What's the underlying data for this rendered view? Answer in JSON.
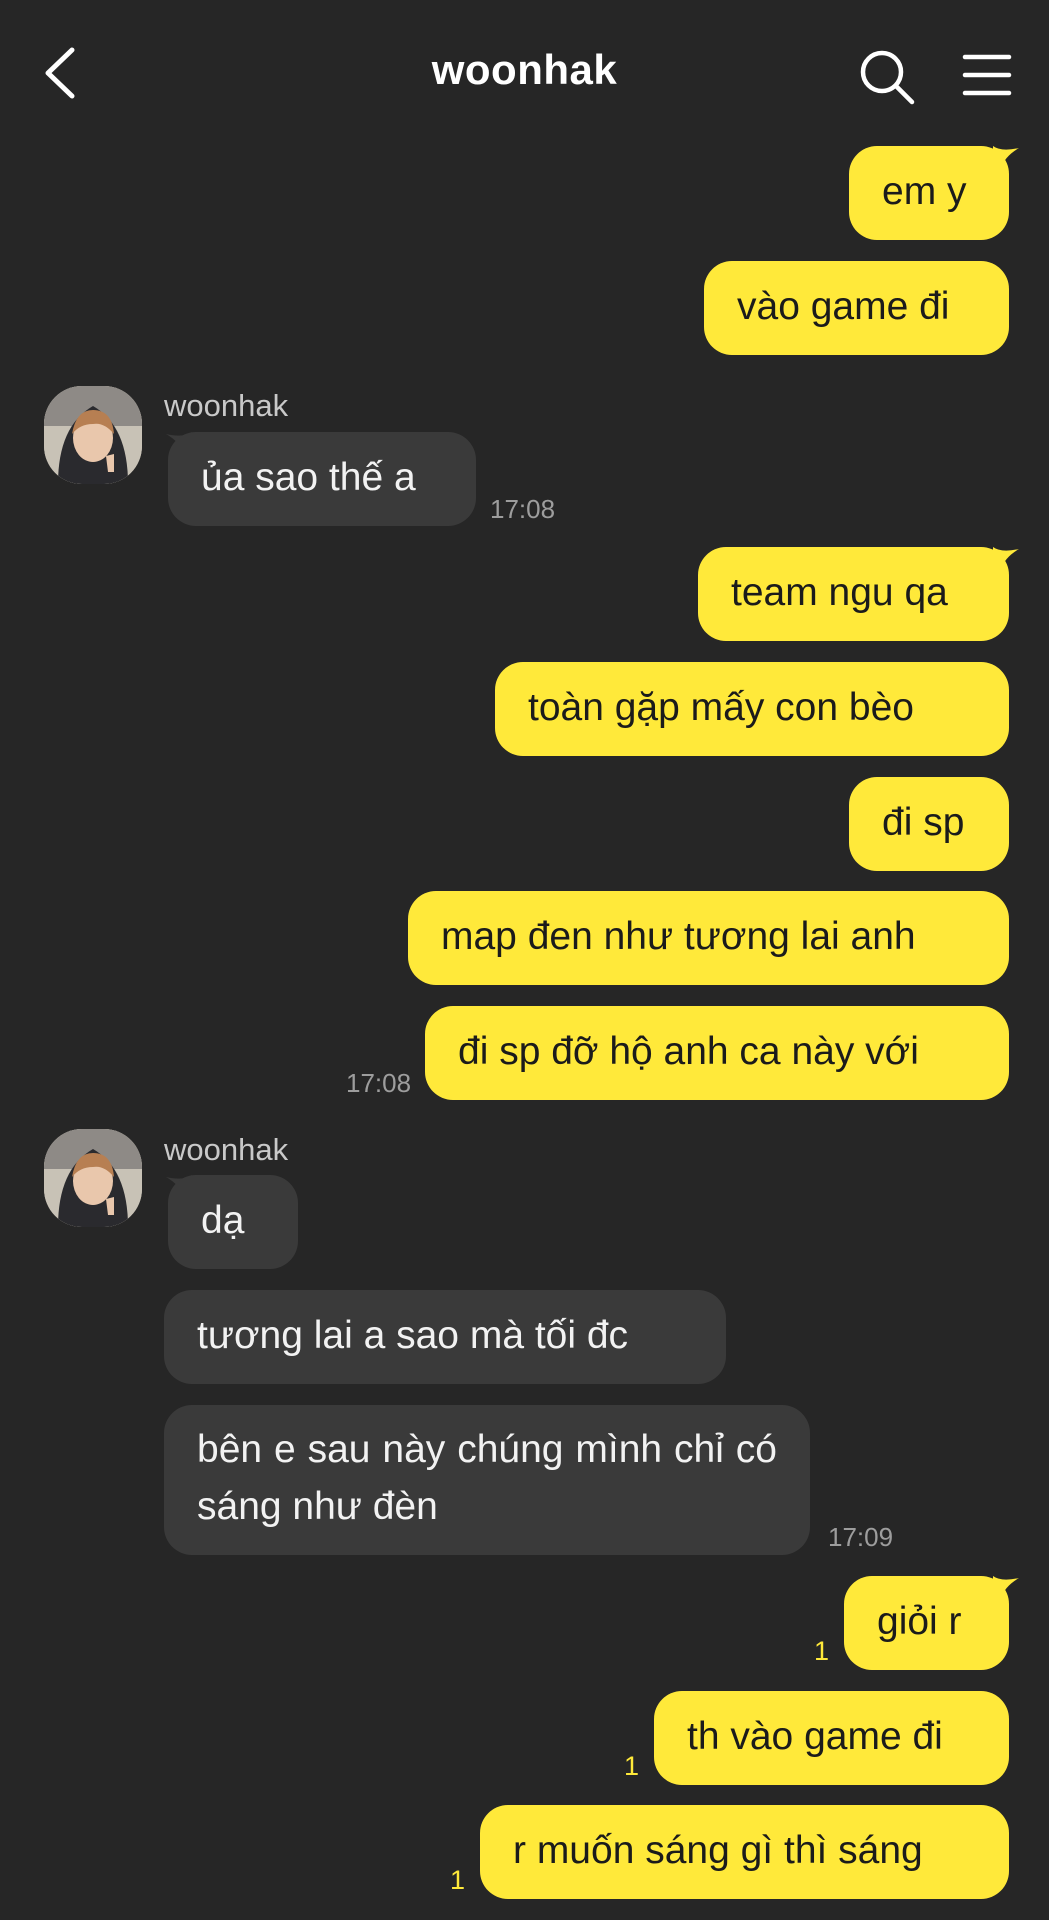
{
  "header": {
    "title": "woonhak",
    "back_icon": "chevron-left-icon",
    "search_icon": "search-icon",
    "menu_icon": "hamburger-menu-icon"
  },
  "colors": {
    "background": "#262626",
    "outgoing_bubble": "#ffe93a",
    "incoming_bubble": "#3a3a3a",
    "unread_count": "#ffe93a",
    "timestamp": "#9d9d9d"
  },
  "messages": [
    {
      "direction": "out",
      "text": "em y"
    },
    {
      "direction": "out",
      "text": "vào game đi"
    },
    {
      "direction": "in",
      "sender": "woonhak",
      "text": "ủa sao thế a",
      "time": "17:08"
    },
    {
      "direction": "out",
      "text": "team ngu qa"
    },
    {
      "direction": "out",
      "text": "toàn gặp mấy con bèo"
    },
    {
      "direction": "out",
      "text": "đi sp"
    },
    {
      "direction": "out",
      "text": "map đen như tương lai anh"
    },
    {
      "direction": "out",
      "text": "đi sp đỡ hộ anh ca này với",
      "time": "17:08"
    },
    {
      "direction": "in",
      "sender": "woonhak",
      "text": "dạ"
    },
    {
      "direction": "in",
      "text": "tương lai a sao mà tối đc"
    },
    {
      "direction": "in",
      "text": "bên e sau này chúng mình chỉ có sáng như đèn",
      "time": "17:09"
    },
    {
      "direction": "out",
      "text": "giỏi r",
      "unread": "1"
    },
    {
      "direction": "out",
      "text": "th vào game đi",
      "unread": "1"
    },
    {
      "direction": "out",
      "text": "r muốn sáng gì thì sáng",
      "unread": "1"
    }
  ]
}
